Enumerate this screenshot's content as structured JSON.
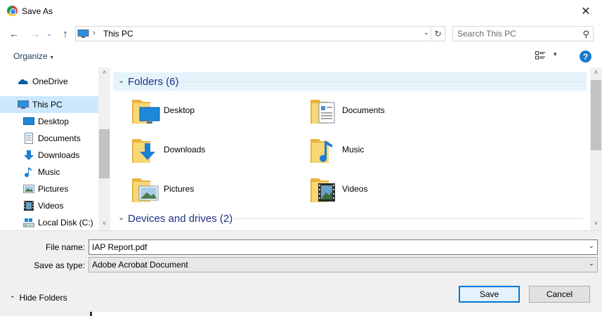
{
  "window": {
    "title": "Save As",
    "close_glyph": "✕"
  },
  "nav": {
    "back_glyph": "←",
    "forward_glyph": "→",
    "recent_glyph": "⌄",
    "up_glyph": "↑",
    "address_sep": "›",
    "address": "This PC",
    "address_drop": "⌄",
    "refresh_glyph": "↻",
    "search_placeholder": "Search This PC",
    "search_glyph": "⚲"
  },
  "toolbar": {
    "organize": "Organize",
    "organize_caret": "▾",
    "view_caret": "▾",
    "help": "?"
  },
  "sidebar": {
    "items": [
      {
        "label": "OneDrive",
        "icon": "onedrive-icon"
      },
      {
        "label": "This PC",
        "icon": "this-pc-icon"
      },
      {
        "label": "Desktop",
        "icon": "desktop-icon"
      },
      {
        "label": "Documents",
        "icon": "documents-icon"
      },
      {
        "label": "Downloads",
        "icon": "downloads-icon"
      },
      {
        "label": "Music",
        "icon": "music-icon"
      },
      {
        "label": "Pictures",
        "icon": "pictures-icon"
      },
      {
        "label": "Videos",
        "icon": "videos-icon"
      },
      {
        "label": "Local Disk (C:)",
        "icon": "local-disk-icon"
      }
    ],
    "scroll_up": "˄",
    "scroll_down": "˅"
  },
  "content": {
    "groups": [
      {
        "title": "Folders (6)",
        "chevron": "⌄"
      },
      {
        "title": "Devices and drives (2)",
        "chevron": "⌄"
      }
    ],
    "folders": [
      {
        "name": "Desktop",
        "icon": "desktop-folder-icon"
      },
      {
        "name": "Documents",
        "icon": "documents-folder-icon"
      },
      {
        "name": "Downloads",
        "icon": "downloads-folder-icon"
      },
      {
        "name": "Music",
        "icon": "music-folder-icon"
      },
      {
        "name": "Pictures",
        "icon": "pictures-folder-icon"
      },
      {
        "name": "Videos",
        "icon": "videos-folder-icon"
      }
    ],
    "scroll_up": "˄",
    "scroll_down": "˅"
  },
  "form": {
    "file_name_label": "File name:",
    "file_name_value": "IAP Report.pdf",
    "save_as_type_label": "Save as type:",
    "save_as_type_value": "Adobe Acrobat Document",
    "dropdown_glyph": "⌄",
    "hide_folders": "Hide Folders",
    "hide_caret": "⌃",
    "save": "Save",
    "cancel": "Cancel"
  },
  "colors": {
    "accent": "#0078d7",
    "selection": "#cce8ff",
    "group_header": "#e5f3fb",
    "group_title": "#1e3287",
    "folder_yellow": "#f8d775"
  }
}
